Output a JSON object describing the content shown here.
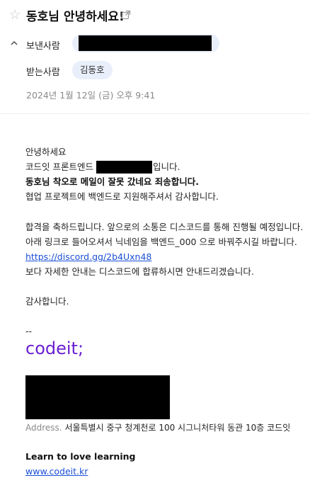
{
  "header": {
    "subject": "동호님 안녕하세요!",
    "from_label": "보낸사람",
    "to_label": "받는사람",
    "recipient": "김동호",
    "date": "2024년 1월 12일 (금) 오후 9:41"
  },
  "body": {
    "greeting": "안녕하세요",
    "line_team_prefix": "코드잇 프론트엔드",
    "line_team_suffix": "입니다.",
    "apology": "동호님 착오로 메일이 잘못 갔네요 죄송합니다.",
    "thanks_apply": "협업 프로젝트에 백엔드로 지원해주셔서 감사합니다.",
    "congrats": "합격을 축하드립니다. 앞으로의 소통은 디스코드를 통해 진행될 예정입니다.",
    "nickname": "아래 링크로 들어오셔서 닉네임을 백엔드_000 으로 바꿔주시길 바랍니다.",
    "discord_link": "https://discord.gg/2b4Uxn48",
    "details": "보다 자세한 안내는 디스코드에 합류하시면 안내드리겠습니다.",
    "closing": "감사합니다."
  },
  "signature": {
    "dash": "--",
    "logo_text": "codeit;",
    "address_label": "Address.",
    "address": "서울특별시 중구 청계천로 100 시그니처타워 동관 10층 코드잇",
    "tagline": "Learn to love learning",
    "website": "www.codeit.kr"
  },
  "colors": {
    "accent_purple": "#6a1fd1",
    "link_blue": "#1a4fd6",
    "pill_bg": "#e9eefb"
  },
  "icons": [
    "star-icon",
    "external-link-icon",
    "chevron-up-icon"
  ]
}
